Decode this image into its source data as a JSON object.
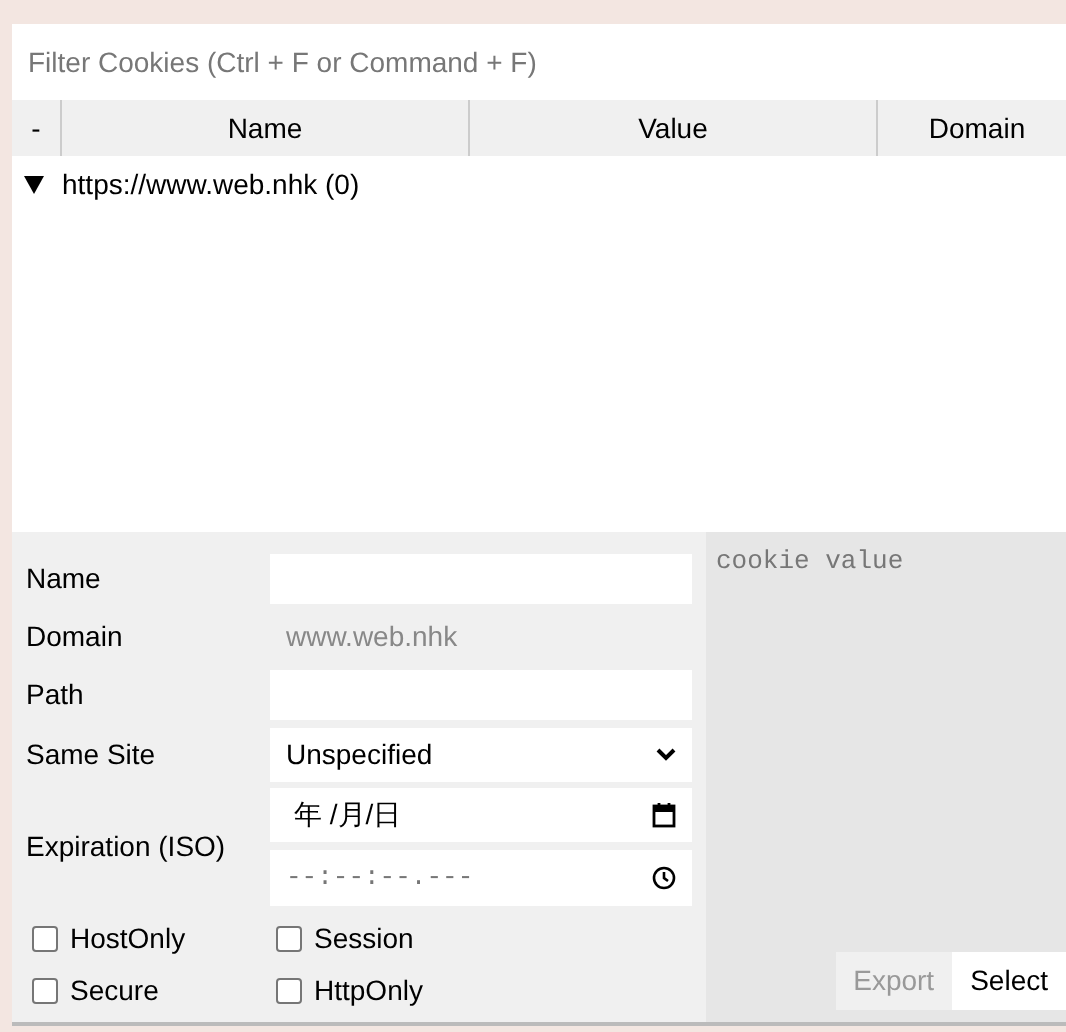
{
  "filter": {
    "placeholder": "Filter Cookies (Ctrl + F or Command + F)"
  },
  "columns": [
    "-",
    "Name",
    "Value",
    "Domain"
  ],
  "tree": [
    {
      "label": "https://www.web.nhk (0)",
      "expanded": true
    }
  ],
  "form": {
    "fields": [
      {
        "kind": "input",
        "label": "Name"
      },
      {
        "kind": "static",
        "label": "Domain",
        "value": "www.web.nhk"
      },
      {
        "kind": "input",
        "label": "Path"
      },
      {
        "kind": "select",
        "label": "Same Site",
        "value": "Unspecified"
      },
      {
        "kind": "datetime",
        "label": "Expiration (ISO)",
        "date_placeholder": "年 /月/日",
        "time_placeholder": "--:--:--.---"
      }
    ],
    "checkboxes": [
      {
        "label": "HostOnly",
        "checked": false
      },
      {
        "label": "Session",
        "checked": false
      },
      {
        "label": "Secure",
        "checked": false
      },
      {
        "label": "HttpOnly",
        "checked": false
      }
    ]
  },
  "value_area": {
    "placeholder": "cookie value"
  },
  "buttons": [
    {
      "label": "Export",
      "disabled": true
    },
    {
      "label": "Select",
      "disabled": false
    }
  ]
}
